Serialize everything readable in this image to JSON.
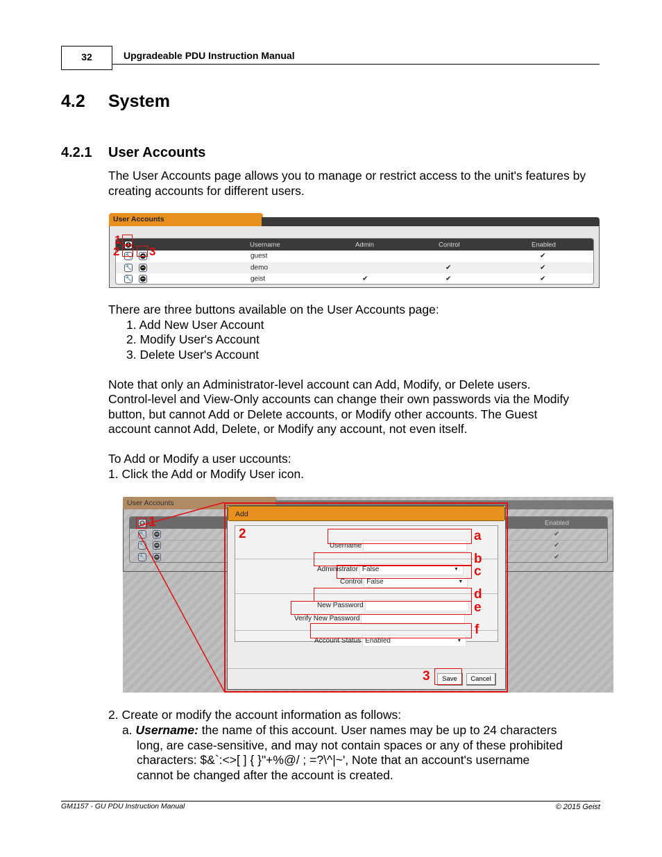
{
  "header": {
    "page_number": "32",
    "manual_title": "Upgradeable PDU Instruction Manual"
  },
  "section": {
    "number": "4.2",
    "title": "System"
  },
  "subsection": {
    "number": "4.2.1",
    "title": "User Accounts"
  },
  "intro": "The User Accounts page allows you to manage or restrict access to the unit's features by creating accounts for different users.",
  "screenshot1": {
    "tab_title": "User Accounts",
    "columns": [
      "Username",
      "Admin",
      "Control",
      "Enabled"
    ],
    "rows": [
      {
        "username": "guest",
        "admin": "",
        "control": "",
        "enabled": "✔"
      },
      {
        "username": "demo",
        "admin": "",
        "control": "✔",
        "enabled": "✔"
      },
      {
        "username": "geist",
        "admin": "✔",
        "control": "✔",
        "enabled": "✔"
      }
    ],
    "callouts": [
      "1",
      "2",
      "3"
    ]
  },
  "buttons_intro": "There are three buttons available on the User Accounts page:",
  "buttons_list": [
    "1. Add New User Account",
    "2. Modify User's Account",
    "3. Delete User's Account"
  ],
  "note": [
    "Note that only an Administrator-level account can Add, Modify, or Delete users.",
    "Control-level and View-Only accounts can change their own passwords via the Modify",
    "button, but cannot Add or Delete accounts, or Modify other accounts.  The Guest",
    "account cannot Add, Delete, or Modify any account, not even itself."
  ],
  "steps_intro": "To Add or Modify a user uccounts:",
  "step1": "1. Click the Add or Modify User icon.",
  "screenshot2": {
    "tab_title": "User Accounts",
    "enabled_header": "Enabled",
    "checks": [
      "✔",
      "✔",
      "✔"
    ],
    "dialog_title": "Add",
    "fields": {
      "username_label": "Username",
      "username_value": "",
      "administrator_label": "Administrator",
      "administrator_value": "False",
      "control_label": "Control",
      "control_value": "False",
      "new_password_label": "New Password",
      "verify_password_label": "Verify New Password",
      "account_status_label": "Account Status",
      "account_status_value": "Enabled"
    },
    "save_label": "Save",
    "cancel_label": "Cancel",
    "callouts": {
      "one": "1",
      "two": "2",
      "three": "3",
      "a": "a",
      "b": "b",
      "c": "c",
      "d": "d",
      "e": "e",
      "f": "f"
    }
  },
  "step2": {
    "intro": "2. Create or modify the account information as follows:",
    "item_a_prefix": "a. ",
    "item_a_term": "Username:",
    "item_a_line1": " the name of this account.  User names may be up to 24 characters",
    "item_a_line2": "long, are case-sensitive, and may not contain spaces or any of these prohibited",
    "item_a_line3": "characters: $&`:<>[ ] { }\"+%@/ ; =?\\^|~',  Note that an account's username",
    "item_a_line4": "cannot be changed after the account is created."
  },
  "footer": {
    "left": "GM1157 - GU PDU Instruction Manual",
    "right": "© 2015 Geist"
  }
}
